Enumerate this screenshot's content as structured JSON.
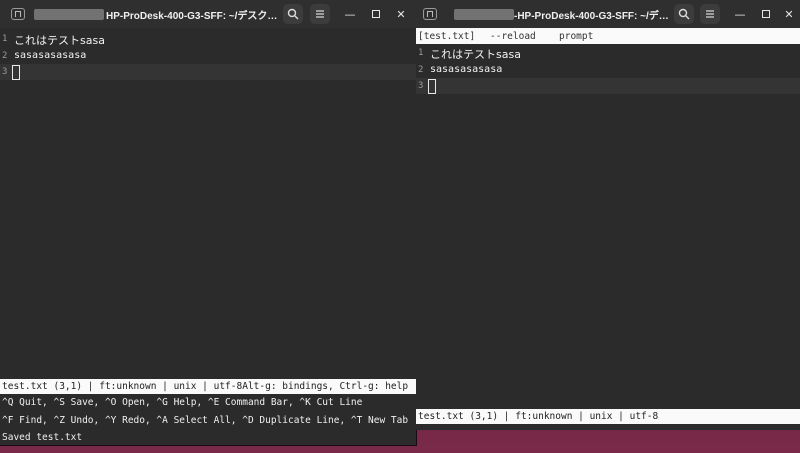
{
  "left_window": {
    "title": "HP-ProDesk-400-G3-SFF: ~/デスク…",
    "lines": [
      {
        "num": "1",
        "text": "これはテストsasa"
      },
      {
        "num": "2",
        "text": "sasasasasasa"
      },
      {
        "num": "3",
        "text": ""
      }
    ],
    "status": "test.txt (3,1) | ft:unknown | unix | utf-8Alt-g: bindings, Ctrl-g: help",
    "help1": "^Q Quit, ^S Save, ^O Open, ^G Help, ^E Command Bar, ^K Cut Line",
    "help2": "^F Find, ^Z Undo, ^Y Redo, ^A Select All, ^D Duplicate Line, ^T New Tab",
    "message": "Saved test.txt"
  },
  "right_window": {
    "title": "-HP-ProDesk-400-G3-SFF: ~/デ…",
    "tab_label": "[test.txt]",
    "tab_reload": "--reload",
    "tab_prompt": "prompt",
    "lines": [
      {
        "num": "1",
        "text": "これはテストsasa"
      },
      {
        "num": "2",
        "text": "sasasasasasa"
      },
      {
        "num": "3",
        "text": ""
      }
    ],
    "status": "test.txt (3,1) | ft:unknown | unix | utf-8"
  },
  "icons": {
    "tab": "new-tab-icon",
    "search": "search-icon",
    "menu": "hamburger-menu-icon",
    "minimize": "minimize-icon",
    "maximize": "maximize-icon",
    "close": "close-icon"
  },
  "colors": {
    "terminal_bg": "#2b2b2b",
    "titlebar_bg": "#2f2f2f",
    "statusbar_bg": "#fafafa",
    "desktop_bg": "#5a1d3e"
  }
}
